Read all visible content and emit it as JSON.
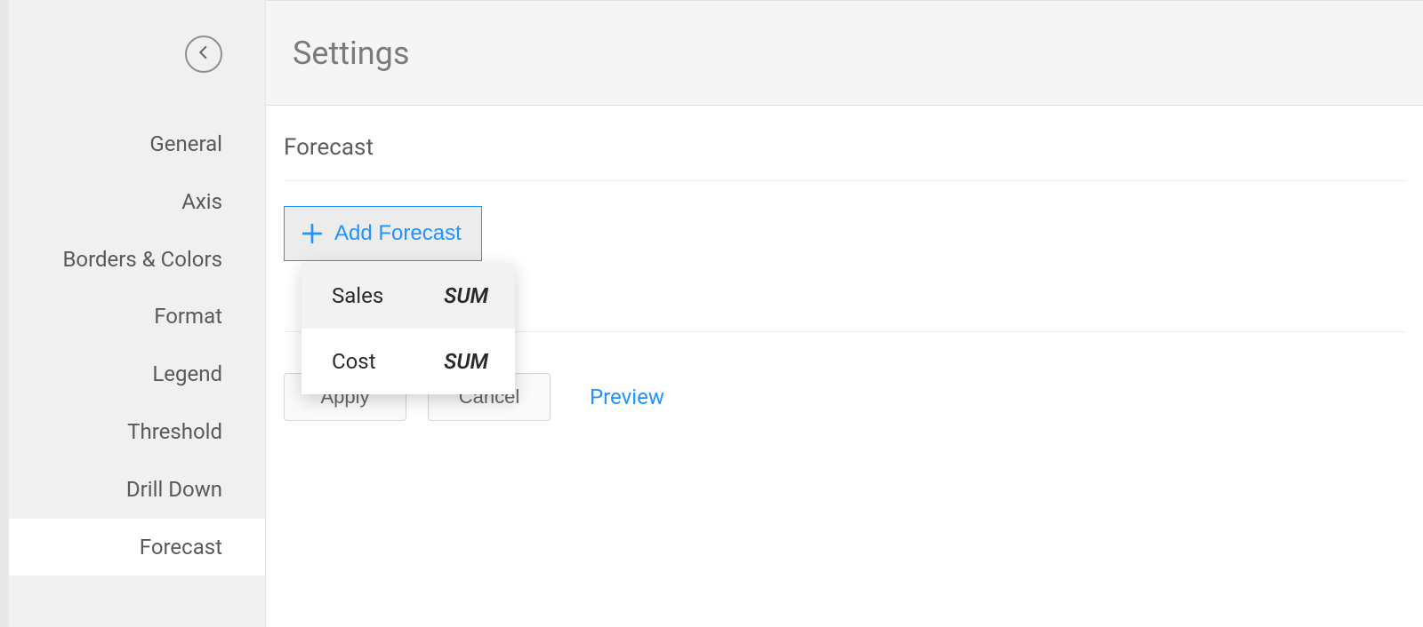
{
  "sidebar": {
    "back_icon": "chevron-left",
    "items": [
      {
        "label": "General"
      },
      {
        "label": "Axis"
      },
      {
        "label": "Borders & Colors"
      },
      {
        "label": "Format"
      },
      {
        "label": "Legend"
      },
      {
        "label": "Threshold"
      },
      {
        "label": "Drill Down"
      },
      {
        "label": "Forecast",
        "active": true
      }
    ]
  },
  "header": {
    "title": "Settings"
  },
  "section": {
    "title": "Forecast",
    "add_label": "Add Forecast",
    "dropdown": [
      {
        "name": "Sales",
        "agg": "SUM"
      },
      {
        "name": "Cost",
        "agg": "SUM"
      }
    ]
  },
  "actions": {
    "apply": "Apply",
    "cancel": "Cancel",
    "preview": "Preview"
  }
}
